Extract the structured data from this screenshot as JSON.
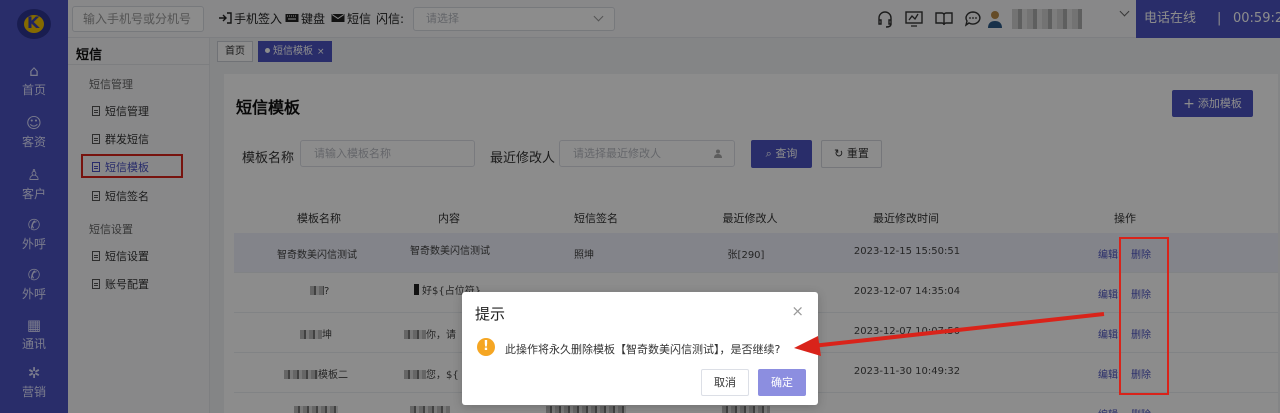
{
  "rail": {
    "items": [
      {
        "label": "首页",
        "icon": "home-icon"
      },
      {
        "label": "客资",
        "icon": "contacts-icon"
      },
      {
        "label": "客户",
        "icon": "customer-icon"
      },
      {
        "label": "外呼",
        "icon": "outbound-call-icon"
      },
      {
        "label": "外呼",
        "icon": "outbound-call-icon"
      },
      {
        "label": "通讯",
        "icon": "calendar-icon"
      },
      {
        "label": "营销",
        "icon": "marketing-icon"
      }
    ]
  },
  "topbar": {
    "phone_placeholder": "输入手机号或分机号",
    "checkin": "手机签入",
    "keyboard": "键盘",
    "sms": "短信",
    "flash_label": "闪信:",
    "flash_placeholder": "请选择",
    "status_label": "电话在线",
    "status_sep": "|",
    "timer": "00:59:25",
    "status_caret": "▼"
  },
  "subnav": {
    "title": "短信",
    "groups": [
      {
        "label": "短信管理",
        "items": [
          "短信管理",
          "群发短信",
          "短信模板",
          "短信签名"
        ]
      },
      {
        "label": "短信设置",
        "items": [
          "短信设置",
          "账号配置"
        ]
      }
    ],
    "active": "短信模板"
  },
  "tabs": {
    "home": "首页",
    "active": "短信模板",
    "close": "×"
  },
  "page": {
    "title": "短信模板",
    "add_button": "添加模板",
    "filter": {
      "name_label": "模板名称",
      "name_placeholder": "请输入模板名称",
      "modifier_label": "最近修改人",
      "modifier_placeholder": "请选择最近修改人",
      "search": "查询",
      "reset": "重置"
    },
    "table": {
      "columns": [
        "模板名称",
        "内容",
        "短信签名",
        "最近修改人",
        "最近修改时间",
        "操作"
      ],
      "rows": [
        {
          "name": "智奇数美闪信测试",
          "content": "智奇数美闪信测试",
          "sign": "照坤",
          "modifier": "张[290]",
          "time": "2023-12-15 15:50:51"
        },
        {
          "name": "?",
          "content": "好${占位符}",
          "sign": "",
          "modifier": "",
          "time": "2023-12-07 14:35:04"
        },
        {
          "name": "坤",
          "content": "你，请",
          "sign": "",
          "modifier": "",
          "time": "2023-12-07 10:07:50"
        },
        {
          "name": "模板二",
          "content": "您，${",
          "sign": "",
          "modifier": "",
          "time": "2023-11-30 10:49:32"
        },
        {
          "name": "",
          "content": "",
          "sign": "",
          "modifier": "",
          "time": ""
        }
      ],
      "edit_label": "编辑",
      "delete_label": "删除"
    }
  },
  "dialog": {
    "title": "提示",
    "close": "×",
    "icon": "!",
    "message": "此操作将永久删除模板【智奇数美闪信测试】，是否继续?",
    "cancel": "取消",
    "confirm": "确定"
  },
  "colors": {
    "brand": "#4b52c2",
    "annotation_red": "#d9231a",
    "warning": "#f5a623"
  }
}
